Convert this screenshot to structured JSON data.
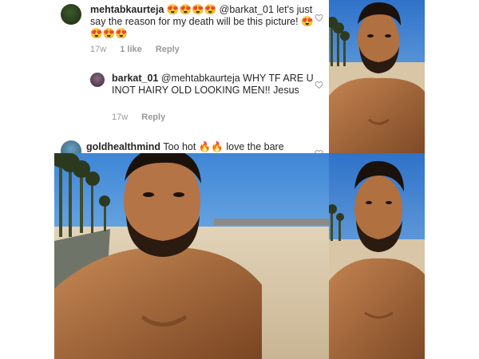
{
  "comments": [
    {
      "username": "mehtabkaurteja",
      "emoji_pre": "😍😍😍😍",
      "text": "@barkat_01 let's just say the reason for my death will be this picture! 😍😍😍😍",
      "time": "17w",
      "likes": "1 like",
      "reply": "Reply"
    },
    {
      "username": "barkat_01",
      "text": "@mehtabkaurteja WHY TF ARE U INOT HAIRY OLD LOOKING MEN!! Jesus",
      "time": "17w",
      "reply": "Reply"
    },
    {
      "username": "goldhealthmind",
      "text": "Too hot 🔥🔥 love the bare"
    }
  ],
  "colors": {
    "sky": "#3a7fd0",
    "sand": "#d9c9ad",
    "skin": "#a86a3e",
    "beard": "#2a1a10"
  },
  "icons": [
    "heart-icon",
    "avatar"
  ]
}
